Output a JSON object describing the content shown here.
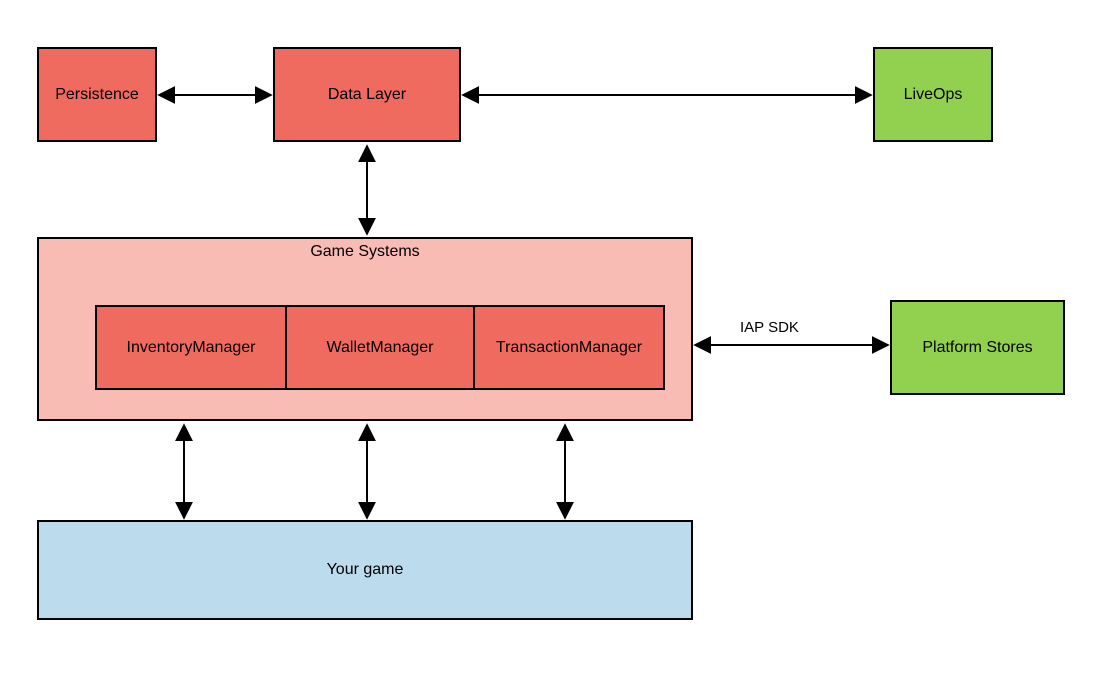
{
  "boxes": {
    "persistence": "Persistence",
    "data_layer": "Data Layer",
    "liveops": "LiveOps",
    "game_systems": "Game Systems",
    "inventory_manager": "InventoryManager",
    "wallet_manager": "WalletManager",
    "transaction_manager": "TransactionManager",
    "platform_stores": "Platform Stores",
    "your_game": "Your game"
  },
  "edges": {
    "iap_sdk": "IAP SDK"
  },
  "colors": {
    "red": "#ef6a5f",
    "pink": "#f9bcb5",
    "green": "#92d050",
    "blue": "#bcdcee"
  }
}
